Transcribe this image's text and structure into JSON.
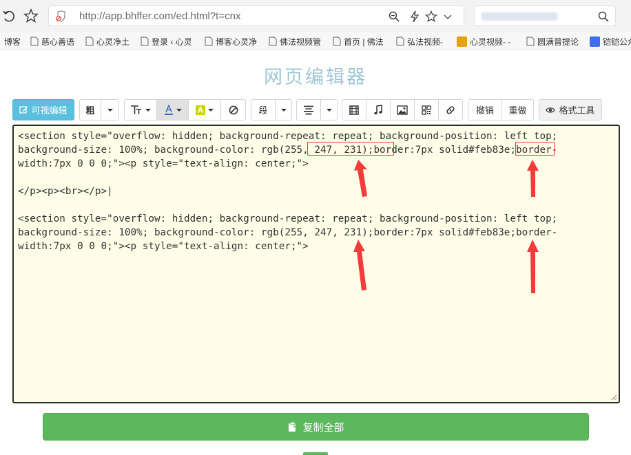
{
  "browser": {
    "url": "http://app.bhffer.com/ed.html?t=cnx",
    "bookmarks": [
      {
        "label": "博客",
        "icon": "none"
      },
      {
        "label": "慈心善语",
        "icon": "page-icon"
      },
      {
        "label": "心灵净土",
        "icon": "page-icon"
      },
      {
        "label": "登录 ‹ 心灵",
        "icon": "page-icon"
      },
      {
        "label": "博客心灵净",
        "icon": "page-icon"
      },
      {
        "label": "佛法视频管",
        "icon": "page-icon"
      },
      {
        "label": "首页 | 佛法",
        "icon": "page-icon"
      },
      {
        "label": "弘法视频-",
        "icon": "page-icon"
      },
      {
        "label": "心灵视频- -",
        "icon": "site-badge-icon"
      },
      {
        "label": "圆满普提论",
        "icon": "page-icon"
      },
      {
        "label": "铠铠公众",
        "icon": "q-badge-icon"
      }
    ]
  },
  "page": {
    "title": "网页编辑器"
  },
  "toolbar": {
    "visual_edit": "可视编辑",
    "bold": "粗",
    "paragraph": "段",
    "undo": "撤销",
    "redo": "重做",
    "format_tool": "格式工具"
  },
  "editor": {
    "lines": [
      "<section style=\"overflow: hidden; background-repeat: repeat; background-position: left top;",
      "background-size: 100%; background-color: rgb(255, 247, 231);border:7px solid#feb83e;border-",
      "width:7px 0 0 0;\"><p style=\"text-align: center;\">",
      "",
      "</p><p><br></p>|",
      "",
      "<section style=\"overflow: hidden; background-repeat: repeat; background-position: left top;",
      "background-size: 100%; background-color: rgb(255, 247, 231);border:7px solid#feb83e;border-",
      "width:7px 0 0 0;\"><p style=\"text-align: center;\">"
    ]
  },
  "footer": {
    "copy_all": "复制全部"
  },
  "colors": {
    "accent_blue": "#5bc0de",
    "copy_green": "#5cb85c",
    "editor_bg": "#fffde7",
    "highlight_red": "#e33a3a",
    "title_color": "#a0c6d6"
  }
}
